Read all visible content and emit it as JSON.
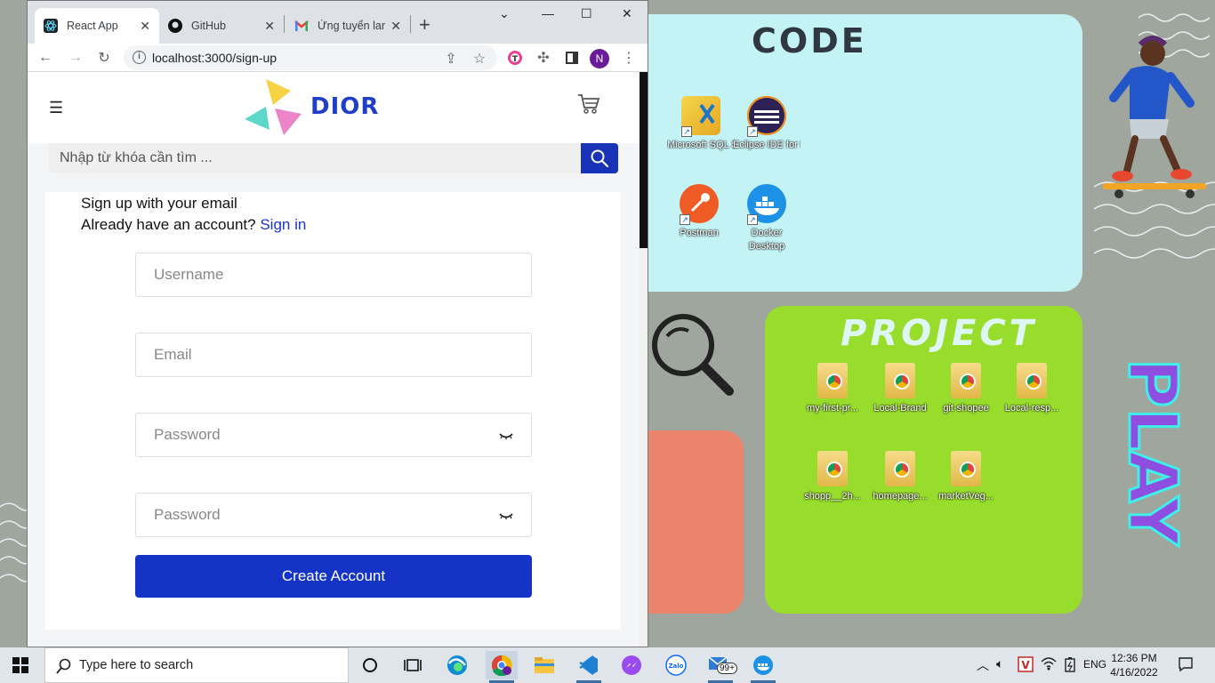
{
  "browser": {
    "tabs": [
      {
        "title": "React App",
        "icon": "react-icon",
        "active": true
      },
      {
        "title": "GitHub",
        "icon": "github-icon",
        "active": false
      },
      {
        "title": "Ứng tuyển lan",
        "icon": "gmail-icon",
        "active": false
      }
    ],
    "url": "localhost:3000/sign-up",
    "profile_initial": "N"
  },
  "site": {
    "logo_text": "DIOR",
    "search_placeholder": "Nhập từ khóa cần tìm ...",
    "signup_title": "Sign up with your email",
    "signin_prompt": "Already have an account?",
    "signin_link": "Sign in",
    "username_placeholder": "Username",
    "email_placeholder": "Email",
    "password_placeholder": "Password",
    "confirm_password_placeholder": "Password",
    "create_button": "Create Account",
    "accent_color": "#1533c4"
  },
  "desktop": {
    "code_title": "CODE",
    "project_title": "PROJECT",
    "play_title": "PLAY",
    "code_icons": [
      {
        "label": "Microsoft SQL Server ...",
        "icon": "sql-server-icon"
      },
      {
        "label": "Eclipse IDE for Enterpri...",
        "icon": "eclipse-icon"
      },
      {
        "label": "Postman",
        "icon": "postman-icon"
      },
      {
        "label": "Docker Desktop",
        "icon": "docker-icon"
      }
    ],
    "project_icons": [
      {
        "label": "my-first-pr..."
      },
      {
        "label": "Local-Brand"
      },
      {
        "label": "git-shopee"
      },
      {
        "label": "Local-resp..."
      },
      {
        "label": "shopp__2h..."
      },
      {
        "label": "homepage..."
      },
      {
        "label": "marketVeg..."
      }
    ]
  },
  "taskbar": {
    "search_placeholder": "Type here to search",
    "mail_badge": "99+",
    "language": "ENG",
    "time": "12:36 PM",
    "date": "4/16/2022"
  }
}
